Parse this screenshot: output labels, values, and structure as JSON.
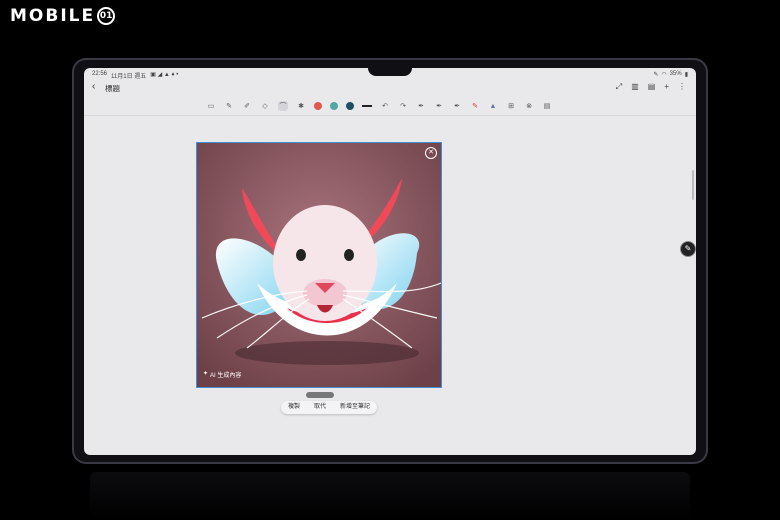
{
  "watermark": {
    "text": "MOBILE",
    "badge": "01"
  },
  "status_bar": {
    "time": "22:56",
    "date": "11月1日 週五",
    "battery": "35%"
  },
  "header": {
    "title": "標題"
  },
  "toolbar": {
    "colors": [
      "#e4574d",
      "#4fa8a3",
      "#1e4f66"
    ],
    "active_tool": "lasso-icon"
  },
  "image": {
    "ai_label": "AI 生成內容"
  },
  "actions": {
    "copy": "複製",
    "replace": "取代",
    "add_note": "新增至筆記"
  },
  "colors": {
    "screen": "#e9e9ec",
    "selection": "#3d8fd8",
    "image_bg": "#8a5a63"
  }
}
